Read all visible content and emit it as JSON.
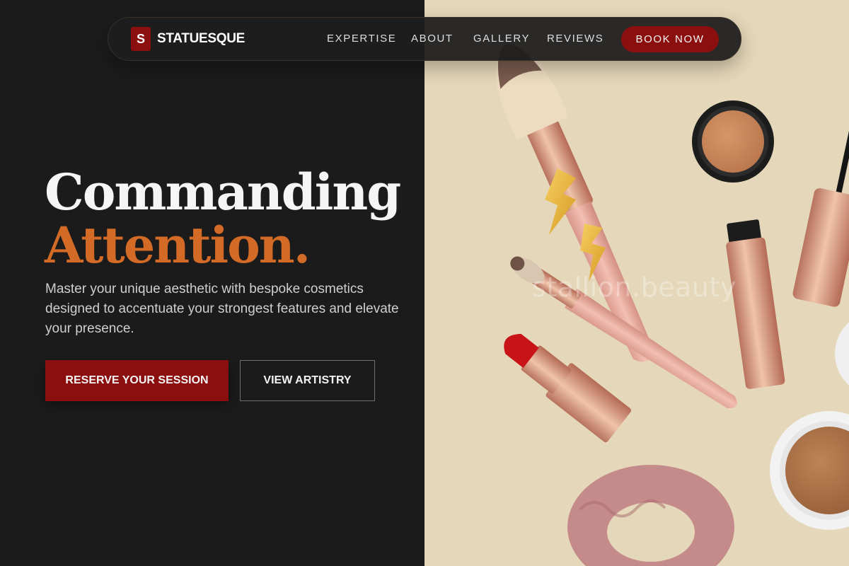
{
  "brand": {
    "logo_letter": "S",
    "name": "STATUESQUE"
  },
  "nav": {
    "links": [
      "EXPERTISE",
      "ABOUT",
      "GALLERY",
      "REVIEWS"
    ],
    "cta_label": "BOOK NOW"
  },
  "hero": {
    "headline_line1": "Commanding",
    "headline_line2": "Attention.",
    "subtitle": "Master your unique aesthetic with bespoke cosmetics designed to accentuate your strongest features and elevate your presence.",
    "primary_button": "RESERVE YOUR SESSION",
    "secondary_button": "VIEW ARTISTRY"
  },
  "image": {
    "watermark": "stallion.beauty"
  },
  "colors": {
    "background_dark": "#1b1b1b",
    "accent_red": "#8b0f0f",
    "accent_orange": "#d36b26",
    "image_background": "#e5d7b9"
  }
}
